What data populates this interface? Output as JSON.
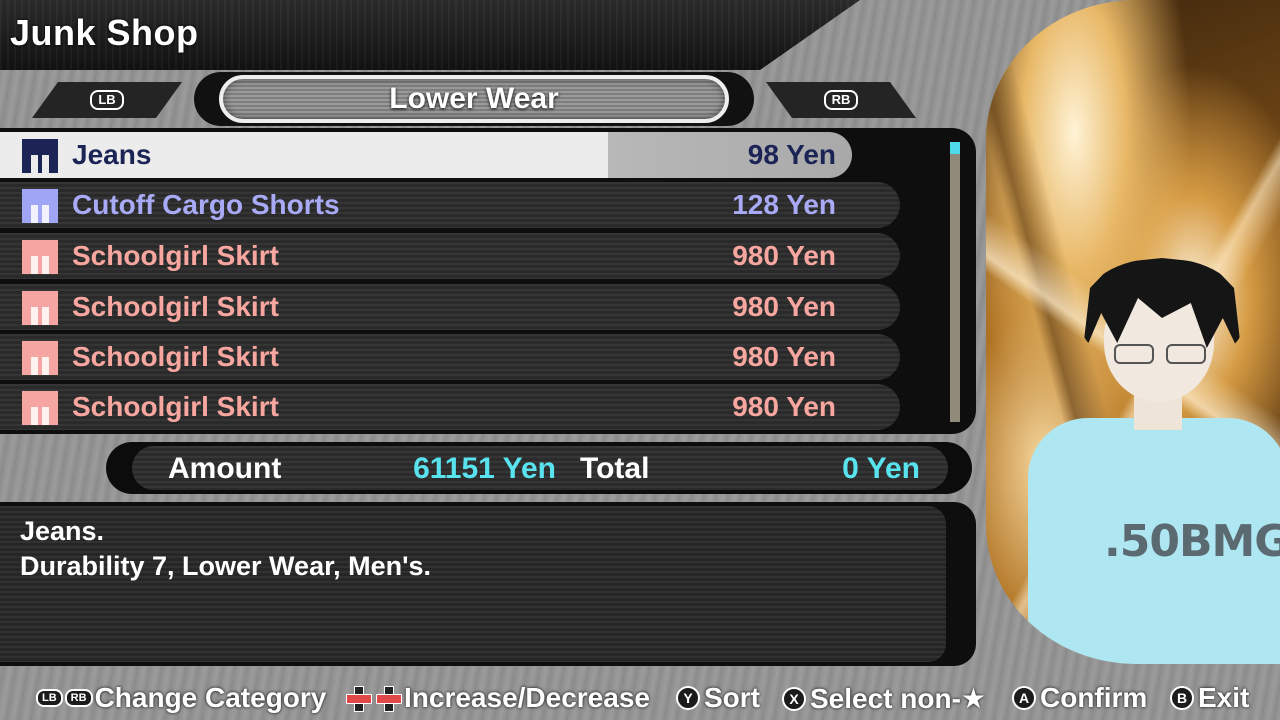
{
  "header": {
    "title": "Junk Shop"
  },
  "category": {
    "prev_button": "LB",
    "next_button": "RB",
    "current": "Lower Wear"
  },
  "items": [
    {
      "name": "Jeans",
      "price": "98 Yen",
      "color": "#1b2455",
      "icon_color": "#1b2455",
      "selected": true
    },
    {
      "name": "Cutoff Cargo Shorts",
      "price": "128 Yen",
      "color": "#a9aaf5",
      "icon_color": "#a0a6f5",
      "selected": false
    },
    {
      "name": "Schoolgirl Skirt",
      "price": "980 Yen",
      "color": "#f7a7a0",
      "icon_color": "#f6a6a2",
      "selected": false
    },
    {
      "name": "Schoolgirl Skirt",
      "price": "980 Yen",
      "color": "#f7a7a0",
      "icon_color": "#f6a6a2",
      "selected": false
    },
    {
      "name": "Schoolgirl Skirt",
      "price": "980 Yen",
      "color": "#f7a7a0",
      "icon_color": "#f6a6a2",
      "selected": false
    },
    {
      "name": "Schoolgirl Skirt",
      "price": "980 Yen",
      "color": "#f7a7a0",
      "icon_color": "#f6a6a2",
      "selected": false
    }
  ],
  "summary": {
    "amount_label": "Amount",
    "amount_value": "61151 Yen",
    "total_label": "Total",
    "total_value": "0 Yen"
  },
  "description": {
    "line1": "Jeans.",
    "line2": "Durability 7, Lower Wear, Men's."
  },
  "portrait": {
    "shirt_text": ".50BMG"
  },
  "footer": {
    "hints": [
      {
        "buttons": [
          "LB",
          "RB"
        ],
        "label": "Change Category"
      },
      {
        "buttons": [
          "dpad",
          "dpad"
        ],
        "label": "Increase/Decrease"
      },
      {
        "buttons": [
          "Y"
        ],
        "label": "Sort"
      },
      {
        "buttons": [
          "X"
        ],
        "label": "Select non-★"
      },
      {
        "buttons": [
          "A"
        ],
        "label": "Confirm"
      },
      {
        "buttons": [
          "B"
        ],
        "label": "Exit"
      }
    ]
  },
  "colors": {
    "accent_cyan": "#59e3ef",
    "selected_row": "#ececec"
  }
}
